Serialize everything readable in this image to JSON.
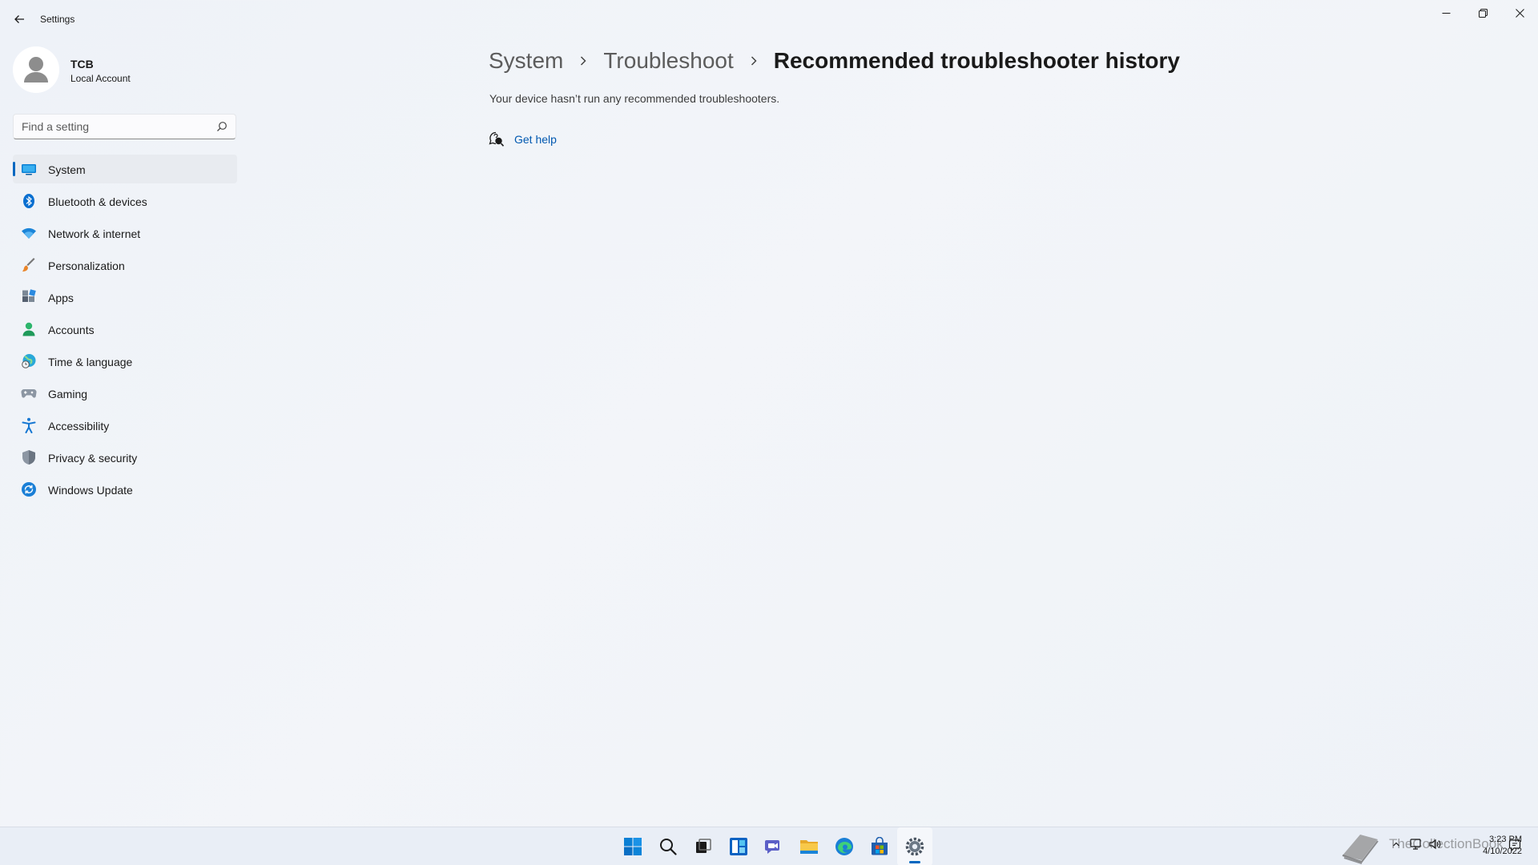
{
  "window": {
    "title": "Settings"
  },
  "profile": {
    "name": "TCB",
    "account_type": "Local Account"
  },
  "search": {
    "placeholder": "Find a setting"
  },
  "sidebar": {
    "items": [
      {
        "label": "System",
        "icon": "system-icon",
        "active": true
      },
      {
        "label": "Bluetooth & devices",
        "icon": "bluetooth-icon"
      },
      {
        "label": "Network & internet",
        "icon": "wifi-icon"
      },
      {
        "label": "Personalization",
        "icon": "paintbrush-icon"
      },
      {
        "label": "Apps",
        "icon": "apps-icon"
      },
      {
        "label": "Accounts",
        "icon": "person-icon"
      },
      {
        "label": "Time & language",
        "icon": "globe-clock-icon"
      },
      {
        "label": "Gaming",
        "icon": "gamepad-icon"
      },
      {
        "label": "Accessibility",
        "icon": "accessibility-icon"
      },
      {
        "label": "Privacy & security",
        "icon": "shield-icon"
      },
      {
        "label": "Windows Update",
        "icon": "update-icon"
      }
    ]
  },
  "main": {
    "breadcrumb": [
      "System",
      "Troubleshoot",
      "Recommended troubleshooter history"
    ],
    "description": "Your device hasn’t run any recommended troubleshooters.",
    "get_help_label": "Get help"
  },
  "taskbar": {
    "apps": [
      "start-icon",
      "search-icon",
      "task-view-icon",
      "widgets-icon",
      "chat-icon",
      "file-explorer-icon",
      "edge-icon",
      "store-icon",
      "settings-icon"
    ],
    "active_app": "settings-icon",
    "watermark_text": "TheCollectionBook",
    "time": "3:23 PM",
    "date": "4/10/2022"
  },
  "colors": {
    "accent": "#0067c0",
    "link": "#0058b0",
    "background": "#f0f3f9"
  }
}
